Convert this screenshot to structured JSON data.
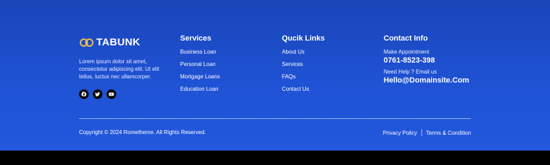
{
  "brand": {
    "logo_text": "TABUNK",
    "description": "Lorem ipsum dolor sit amet, consectetur adipiscing elit. Ut elit tellus, luctus nec ullamcorper."
  },
  "services": {
    "title": "Services",
    "items": [
      "Business Loan",
      "Personal Loan",
      "Mortgage Loans",
      "Education Loan"
    ]
  },
  "quick_links": {
    "title": "Qucik Links",
    "items": [
      "About Us",
      "Services",
      "FAQs",
      "Contact Us"
    ]
  },
  "contact": {
    "title": "Contact Info",
    "appointment_label": "Make Appointment",
    "phone": "0761-8523-398",
    "email_label": "Need Help ? Email us",
    "email": "Hello@Domainsite.Com"
  },
  "bottom": {
    "copyright": "Copyright © 2024 Rometheme. All Rights Reserved.",
    "privacy": "Privacy Policy",
    "terms": "Terms & Condition"
  },
  "social_icons": [
    "facebook-icon",
    "twitter-icon",
    "youtube-icon"
  ],
  "colors": {
    "background": "#1f52d4",
    "social_button": "#0b0b0b",
    "text": "#ffffff"
  }
}
